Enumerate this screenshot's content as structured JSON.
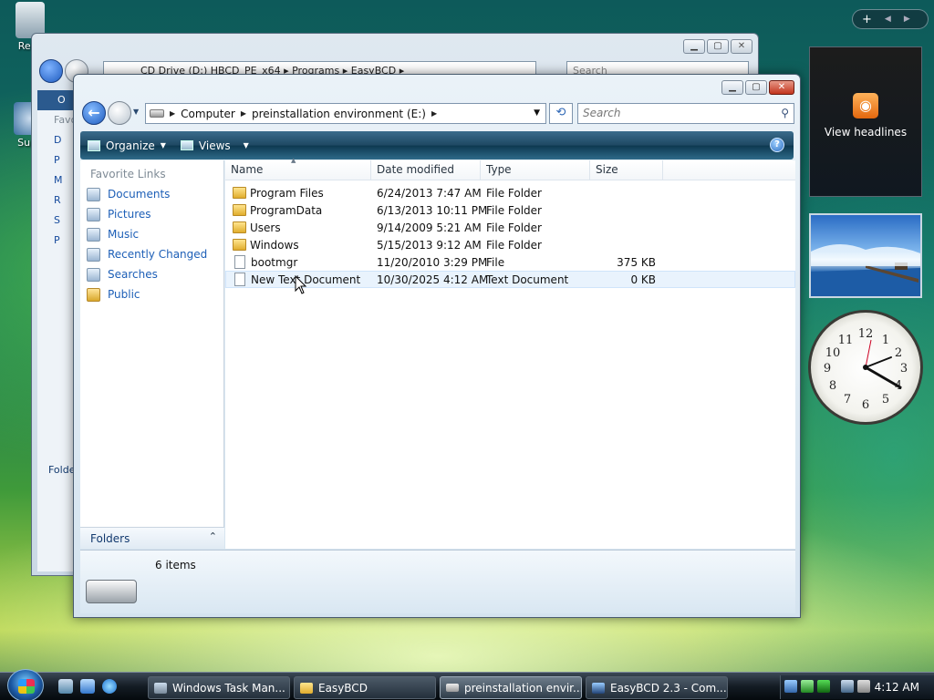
{
  "desktop": {
    "icons": [
      {
        "label": "Recy"
      },
      {
        "label": "Supe"
      }
    ]
  },
  "back_window": {
    "address": "CD Drive (D:) HBCD_PE_x64 ▸ Programs ▸ EasyBCD ▸",
    "search_placeholder": "Search",
    "nav_items": [
      "O",
      "Favo",
      "D",
      "P",
      "M",
      "R",
      "S",
      "P",
      "Folde"
    ]
  },
  "window": {
    "caption": {
      "minimize": "▁",
      "maximize": "▢",
      "close": "✕"
    },
    "address": {
      "segments": [
        "Computer",
        "preinstallation environment (E:)"
      ]
    },
    "search_placeholder": "Search",
    "toolbar": {
      "organize": "Organize",
      "views": "Views"
    },
    "nav_pane": {
      "header": "Favorite Links",
      "links": [
        "Documents",
        "Pictures",
        "Music",
        "Recently Changed",
        "Searches",
        "Public"
      ],
      "folders": "Folders"
    },
    "columns": [
      "Name",
      "Date modified",
      "Type",
      "Size"
    ],
    "files": [
      {
        "name": "Program Files",
        "date": "6/24/2013 7:47 AM",
        "type": "File Folder",
        "size": "",
        "kind": "folder"
      },
      {
        "name": "ProgramData",
        "date": "6/13/2013 10:11 PM",
        "type": "File Folder",
        "size": "",
        "kind": "folder"
      },
      {
        "name": "Users",
        "date": "9/14/2009 5:21 AM",
        "type": "File Folder",
        "size": "",
        "kind": "folder"
      },
      {
        "name": "Windows",
        "date": "5/15/2013 9:12 AM",
        "type": "File Folder",
        "size": "",
        "kind": "folder"
      },
      {
        "name": "bootmgr",
        "date": "11/20/2010 3:29 PM",
        "type": "File",
        "size": "375 KB",
        "kind": "file"
      },
      {
        "name": "New Text Document",
        "date": "10/30/2025 4:12 AM",
        "type": "Text Document",
        "size": "0 KB",
        "kind": "file"
      }
    ],
    "item_count": "6 items"
  },
  "sidebar": {
    "feed_label": "View headlines",
    "clock_numbers": [
      "12",
      "1",
      "2",
      "3",
      "4",
      "5",
      "6",
      "7",
      "8",
      "9",
      "10",
      "11"
    ]
  },
  "taskbar": {
    "buttons": [
      {
        "label": "Windows Task Man..."
      },
      {
        "label": "EasyBCD"
      },
      {
        "label": "preinstallation envir..."
      },
      {
        "label": "EasyBCD 2.3 - Com..."
      }
    ],
    "clock": "4:12 AM"
  }
}
